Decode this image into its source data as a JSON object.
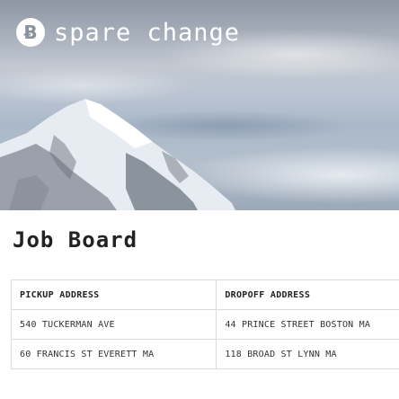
{
  "header": {
    "logo_icon": "bitcoin-icon",
    "logo_glyph": "Ƀ",
    "title": "Spare Change"
  },
  "page": {
    "title": "Job Board"
  },
  "table": {
    "headers": [
      "Pickup Address",
      "Dropoff Address"
    ],
    "rows": [
      [
        "540 Tuckerman Ave",
        "44 Prince Street Boston MA"
      ],
      [
        "60 Francis St Everett Ma",
        "118 Broad st Lynn Ma"
      ]
    ]
  },
  "colors": {
    "text": "#222222",
    "border": "#dcdcdc",
    "header_text": "#ffffff"
  }
}
